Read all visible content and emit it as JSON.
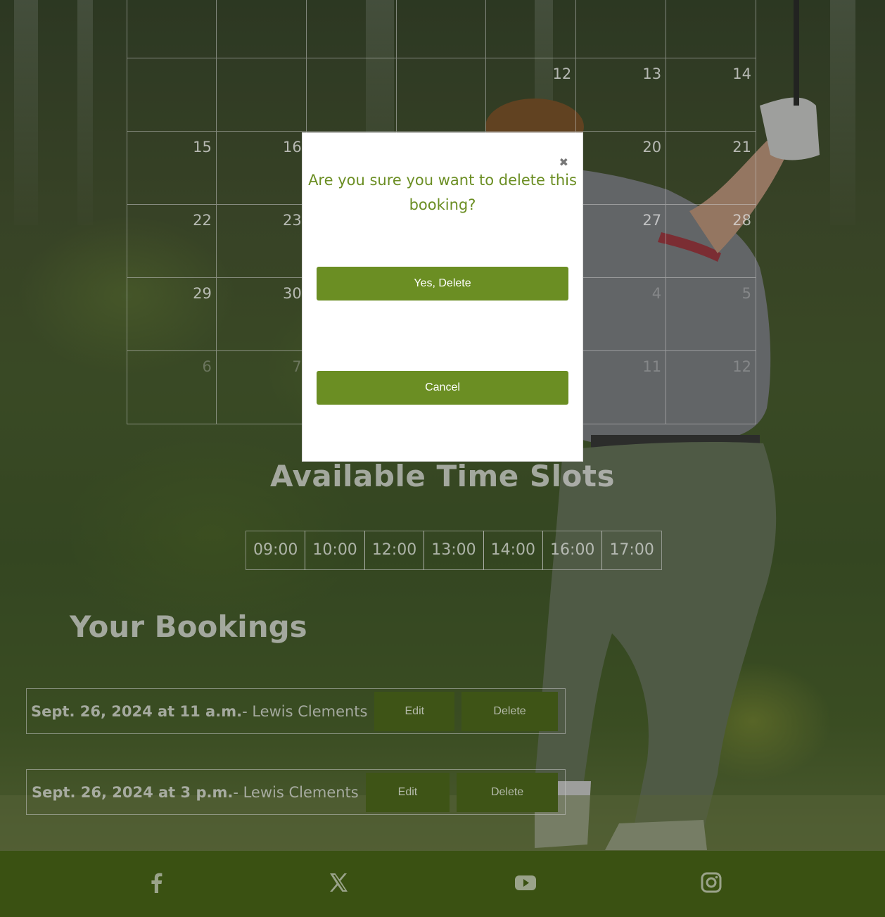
{
  "calendar": {
    "rows": [
      [
        {
          "day": "",
          "other": false
        },
        {
          "day": "",
          "other": false
        },
        {
          "day": "",
          "other": false
        },
        {
          "day": "",
          "other": false
        },
        {
          "day": "",
          "other": false
        },
        {
          "day": "",
          "other": false
        },
        {
          "day": "",
          "other": false
        }
      ],
      [
        {
          "day": "",
          "other": false
        },
        {
          "day": "",
          "other": false
        },
        {
          "day": "",
          "other": false
        },
        {
          "day": "",
          "other": false
        },
        {
          "day": "12",
          "other": false
        },
        {
          "day": "13",
          "other": false
        },
        {
          "day": "14",
          "other": false
        }
      ],
      [
        {
          "day": "15",
          "other": false
        },
        {
          "day": "16",
          "other": false
        },
        {
          "day": "",
          "other": false
        },
        {
          "day": "",
          "other": false
        },
        {
          "day": "",
          "other": false
        },
        {
          "day": "20",
          "other": false
        },
        {
          "day": "21",
          "other": false
        }
      ],
      [
        {
          "day": "22",
          "other": false
        },
        {
          "day": "23",
          "other": false
        },
        {
          "day": "",
          "other": false
        },
        {
          "day": "",
          "other": false
        },
        {
          "day": "",
          "other": false
        },
        {
          "day": "27",
          "other": false
        },
        {
          "day": "28",
          "other": false
        }
      ],
      [
        {
          "day": "29",
          "other": false
        },
        {
          "day": "30",
          "other": false
        },
        {
          "day": "",
          "other": false
        },
        {
          "day": "",
          "other": false
        },
        {
          "day": "",
          "other": false
        },
        {
          "day": "4",
          "other": true
        },
        {
          "day": "5",
          "other": true
        }
      ],
      [
        {
          "day": "6",
          "other": true
        },
        {
          "day": "7",
          "other": true
        },
        {
          "day": "",
          "other": true
        },
        {
          "day": "",
          "other": true
        },
        {
          "day": "",
          "other": true
        },
        {
          "day": "11",
          "other": true
        },
        {
          "day": "12",
          "other": true
        }
      ]
    ]
  },
  "time_slots": {
    "title": "Available Time Slots",
    "slots": [
      "09:00",
      "10:00",
      "12:00",
      "13:00",
      "14:00",
      "16:00",
      "17:00"
    ]
  },
  "bookings": {
    "title": "Your Bookings",
    "items": [
      {
        "date": "Sept. 26, 2024 at 11 a.m.",
        "name": "- Lewis Clements",
        "edit_label": "Edit",
        "delete_label": "Delete"
      },
      {
        "date": "Sept. 26, 2024 at 3 p.m.",
        "name": "- Lewis Clements",
        "edit_label": "Edit",
        "delete_label": "Delete"
      }
    ]
  },
  "modal": {
    "close_glyph": "✖",
    "title": "Are you sure you want to delete this booking?",
    "confirm_label": "Yes, Delete",
    "cancel_label": "Cancel"
  },
  "footer": {
    "icons": [
      "facebook-icon",
      "x-twitter-icon",
      "youtube-icon",
      "instagram-icon"
    ]
  },
  "colors": {
    "accent": "#6b8e23",
    "footer": "#3a5112",
    "booking_button": "#3e5416"
  }
}
